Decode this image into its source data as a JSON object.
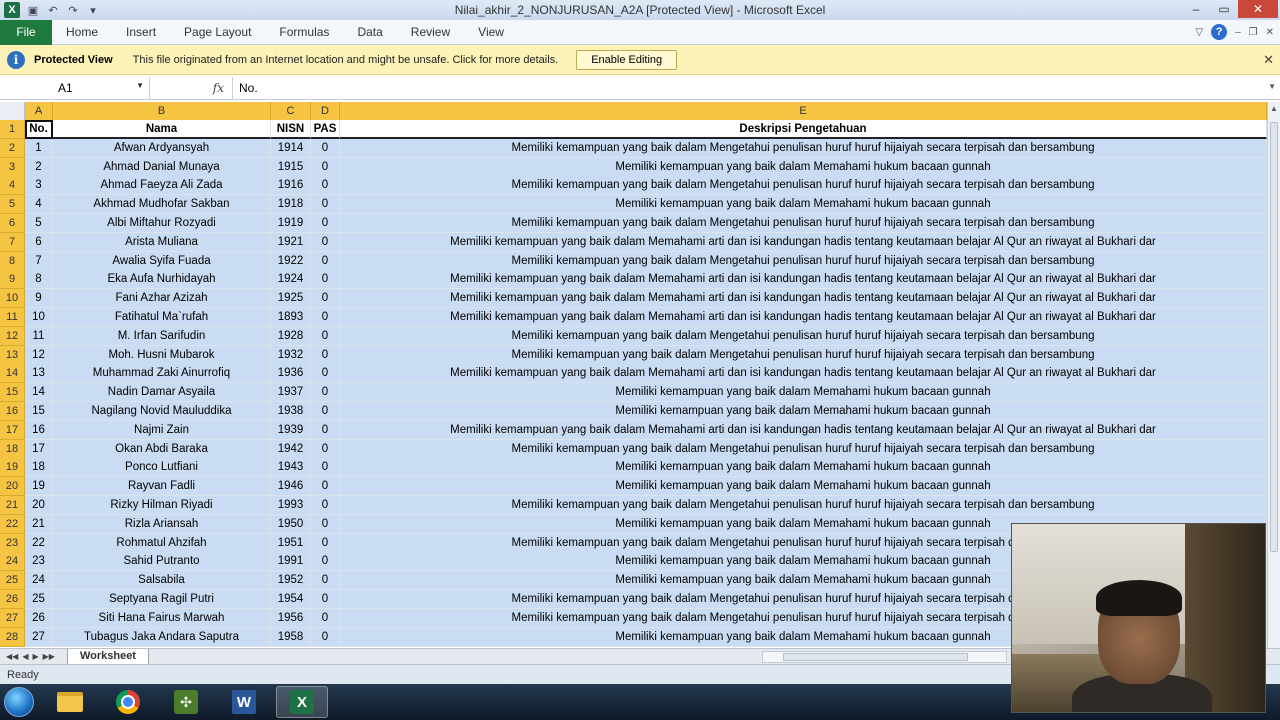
{
  "window": {
    "title": "Nilai_akhir_2_NONJURUSAN_A2A  [Protected View] - Microsoft Excel"
  },
  "ribbon": {
    "file_label": "File",
    "tabs": [
      "Home",
      "Insert",
      "Page Layout",
      "Formulas",
      "Data",
      "Review",
      "View"
    ]
  },
  "protected_view": {
    "title": "Protected View",
    "message": "This file originated from an Internet location and might be unsafe. Click for more details.",
    "button_label": "Enable Editing"
  },
  "formula_bar": {
    "name_box": "A1",
    "fx": "fx",
    "value": "No."
  },
  "columns": [
    "A",
    "B",
    "C",
    "D",
    "E"
  ],
  "header_row": {
    "row_number": "1",
    "no": "No.",
    "nama": "Nama",
    "nisn": "NISN",
    "pas": "PAS",
    "deskripsi": "Deskripsi Pengetahuan"
  },
  "rows": [
    {
      "r": "2",
      "no": "1",
      "nama": "Afwan Ardyansyah",
      "nisn": "1914",
      "pas": "0",
      "desc": "Memiliki kemampuan yang baik dalam Mengetahui penulisan huruf huruf hijaiyah secara terpisah dan bersambung"
    },
    {
      "r": "3",
      "no": "2",
      "nama": "Ahmad Danial Munaya",
      "nisn": "1915",
      "pas": "0",
      "desc": "Memiliki kemampuan yang baik dalam Memahami  hukum bacaan gunnah"
    },
    {
      "r": "4",
      "no": "3",
      "nama": "Ahmad Faeyza Ali Zada",
      "nisn": "1916",
      "pas": "0",
      "desc": "Memiliki kemampuan yang baik dalam Mengetahui penulisan huruf huruf hijaiyah secara terpisah dan bersambung"
    },
    {
      "r": "5",
      "no": "4",
      "nama": "Akhmad Mudhofar Sakban",
      "nisn": "1918",
      "pas": "0",
      "desc": "Memiliki kemampuan yang baik dalam Memahami  hukum bacaan gunnah"
    },
    {
      "r": "6",
      "no": "5",
      "nama": "Albi Miftahur Rozyadi",
      "nisn": "1919",
      "pas": "0",
      "desc": "Memiliki kemampuan yang baik dalam Mengetahui penulisan huruf huruf hijaiyah secara terpisah dan bersambung"
    },
    {
      "r": "7",
      "no": "6",
      "nama": "Arista Muliana",
      "nisn": "1921",
      "pas": "0",
      "desc": "Memiliki kemampuan yang baik dalam Memahami arti dan isi kandungan hadis tentang keutamaan belajar Al Qur an riwayat al Bukhari dar"
    },
    {
      "r": "8",
      "no": "7",
      "nama": "Awalia Syifa Fuada",
      "nisn": "1922",
      "pas": "0",
      "desc": "Memiliki kemampuan yang baik dalam Mengetahui penulisan huruf huruf hijaiyah secara terpisah dan bersambung"
    },
    {
      "r": "9",
      "no": "8",
      "nama": "Eka Aufa Nurhidayah",
      "nisn": "1924",
      "pas": "0",
      "desc": "Memiliki kemampuan yang baik dalam Memahami arti dan isi kandungan hadis tentang keutamaan belajar Al Qur an riwayat al Bukhari dar"
    },
    {
      "r": "10",
      "no": "9",
      "nama": "Fani Azhar Azizah",
      "nisn": "1925",
      "pas": "0",
      "desc": "Memiliki kemampuan yang baik dalam Memahami arti dan isi kandungan hadis tentang keutamaan belajar Al Qur an riwayat al Bukhari dar"
    },
    {
      "r": "11",
      "no": "10",
      "nama": "Fatihatul Ma`rufah",
      "nisn": "1893",
      "pas": "0",
      "desc": "Memiliki kemampuan yang baik dalam Memahami arti dan isi kandungan hadis tentang keutamaan belajar Al Qur an riwayat al Bukhari dar"
    },
    {
      "r": "12",
      "no": "11",
      "nama": "M. Irfan Sarifudin",
      "nisn": "1928",
      "pas": "0",
      "desc": "Memiliki kemampuan yang baik dalam Mengetahui penulisan huruf huruf hijaiyah secara terpisah dan bersambung"
    },
    {
      "r": "13",
      "no": "12",
      "nama": "Moh. Husni Mubarok",
      "nisn": "1932",
      "pas": "0",
      "desc": "Memiliki kemampuan yang baik dalam Mengetahui penulisan huruf huruf hijaiyah secara terpisah dan bersambung"
    },
    {
      "r": "14",
      "no": "13",
      "nama": "Muhammad Zaki Ainurrofiq",
      "nisn": "1936",
      "pas": "0",
      "desc": "Memiliki kemampuan yang baik dalam Memahami arti dan isi kandungan hadis tentang keutamaan belajar Al Qur an riwayat al Bukhari dar"
    },
    {
      "r": "15",
      "no": "14",
      "nama": "Nadin Damar Asyaila",
      "nisn": "1937",
      "pas": "0",
      "desc": "Memiliki kemampuan yang baik dalam Memahami  hukum bacaan gunnah"
    },
    {
      "r": "16",
      "no": "15",
      "nama": "Nagilang Novid Mauluddika",
      "nisn": "1938",
      "pas": "0",
      "desc": "Memiliki kemampuan yang baik dalam Memahami  hukum bacaan gunnah"
    },
    {
      "r": "17",
      "no": "16",
      "nama": "Najmi Zain",
      "nisn": "1939",
      "pas": "0",
      "desc": "Memiliki kemampuan yang baik dalam Memahami arti dan isi kandungan hadis tentang keutamaan belajar Al Qur an riwayat al Bukhari dar"
    },
    {
      "r": "18",
      "no": "17",
      "nama": "Okan Abdi Baraka",
      "nisn": "1942",
      "pas": "0",
      "desc": "Memiliki kemampuan yang baik dalam Mengetahui penulisan huruf huruf hijaiyah secara terpisah dan bersambung"
    },
    {
      "r": "19",
      "no": "18",
      "nama": "Ponco Lutfiani",
      "nisn": "1943",
      "pas": "0",
      "desc": "Memiliki kemampuan yang baik dalam Memahami  hukum bacaan gunnah"
    },
    {
      "r": "20",
      "no": "19",
      "nama": "Rayvan Fadli",
      "nisn": "1946",
      "pas": "0",
      "desc": "Memiliki kemampuan yang baik dalam Memahami  hukum bacaan gunnah"
    },
    {
      "r": "21",
      "no": "20",
      "nama": "Rizky Hilman Riyadi",
      "nisn": "1993",
      "pas": "0",
      "desc": "Memiliki kemampuan yang baik dalam Mengetahui penulisan huruf huruf hijaiyah secara terpisah dan bersambung"
    },
    {
      "r": "22",
      "no": "21",
      "nama": "Rizla Ariansah",
      "nisn": "1950",
      "pas": "0",
      "desc": "Memiliki kemampuan yang baik dalam Memahami  hukum bacaan gunnah"
    },
    {
      "r": "23",
      "no": "22",
      "nama": "Rohmatul Ahzifah",
      "nisn": "1951",
      "pas": "0",
      "desc": "Memiliki kemampuan yang baik dalam Mengetahui penulisan huruf huruf hijaiyah secara terpisah dan bersambung"
    },
    {
      "r": "24",
      "no": "23",
      "nama": "Sahid Putranto",
      "nisn": "1991",
      "pas": "0",
      "desc": "Memiliki kemampuan yang baik dalam Memahami  hukum bacaan gunnah"
    },
    {
      "r": "25",
      "no": "24",
      "nama": "Salsabila",
      "nisn": "1952",
      "pas": "0",
      "desc": "Memiliki kemampuan yang baik dalam Memahami  hukum bacaan gunnah"
    },
    {
      "r": "26",
      "no": "25",
      "nama": "Septyana Ragil Putri",
      "nisn": "1954",
      "pas": "0",
      "desc": "Memiliki kemampuan yang baik dalam Mengetahui penulisan huruf huruf hijaiyah secara terpisah dan bersambung"
    },
    {
      "r": "27",
      "no": "26",
      "nama": "Siti Hana Fairus Marwah",
      "nisn": "1956",
      "pas": "0",
      "desc": "Memiliki kemampuan yang baik dalam Mengetahui penulisan huruf huruf hijaiyah secara terpisah dan bersambung"
    },
    {
      "r": "28",
      "no": "27",
      "nama": "Tubagus Jaka Andara Saputra",
      "nisn": "1958",
      "pas": "0",
      "desc": "Memiliki kemampuan yang baik dalam Memahami  hukum bacaan gunnah"
    }
  ],
  "sheet_tabs": [
    "Worksheet"
  ],
  "status": "Ready",
  "taskbar": {
    "apps": [
      {
        "icon": "windows-explorer-icon",
        "glyph": ""
      },
      {
        "icon": "chrome-icon",
        "glyph": ""
      },
      {
        "icon": "game-icon",
        "glyph": "✣"
      },
      {
        "icon": "word-icon",
        "glyph": "W"
      },
      {
        "icon": "excel-icon",
        "glyph": "X"
      }
    ]
  },
  "colors": {
    "header_orange": "#f6c443",
    "selection_blue": "#c9dcf3",
    "file_tab_green": "#1f7a3e",
    "protected_bar_yellow": "#fdf3b8"
  }
}
